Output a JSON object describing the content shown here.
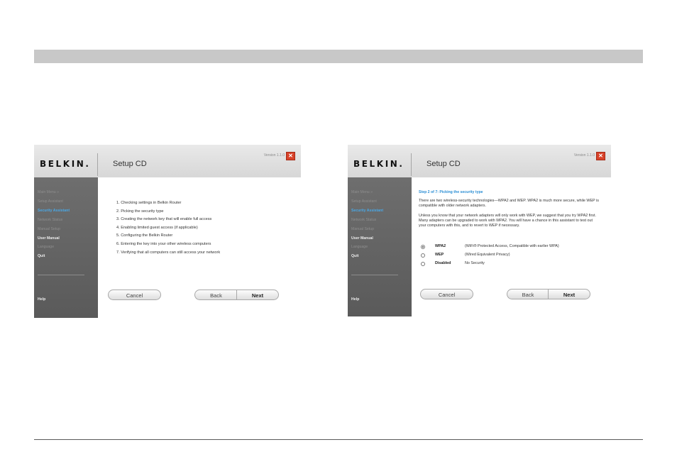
{
  "window_left": {
    "logo": "BELKIN.",
    "title": "Setup CD",
    "version": "Version 1.1.0",
    "sidebar": {
      "items": [
        {
          "label": "Main Menu  »"
        },
        {
          "label": "Setup Assistant"
        },
        {
          "label": "Security Assistant"
        },
        {
          "label": "Network Status"
        },
        {
          "label": "Manual Setup"
        },
        {
          "label": "User Manual"
        },
        {
          "label": "Language"
        },
        {
          "label": "Quit"
        }
      ],
      "help": "Help"
    },
    "steps": [
      "1. Checking settings in Belkin Router",
      "2. Picking the security type",
      "3. Creating the network key that will enable full access",
      "4. Enabling limited guest access (if applicable)",
      "5. Configuring the Belkin Router",
      "6. Entering the key into your other wireless computers",
      "7. Verifying that all computers can still access your network"
    ],
    "buttons": {
      "cancel": "Cancel",
      "back": "Back",
      "next": "Next"
    }
  },
  "window_right": {
    "logo": "BELKIN.",
    "title": "Setup CD",
    "version": "Version 1.1.0",
    "sidebar": {
      "items": [
        {
          "label": "Main Menu  »"
        },
        {
          "label": "Setup Assistant"
        },
        {
          "label": "Security Assistant"
        },
        {
          "label": "Network Status"
        },
        {
          "label": "Manual Setup"
        },
        {
          "label": "User Manual"
        },
        {
          "label": "Language"
        },
        {
          "label": "Quit"
        }
      ],
      "help": "Help"
    },
    "step_header": "Step 2 of 7: Picking the security type",
    "para1": "There are two wireless-security technologies—WPA2 and WEP. WPA2 is much more secure, while WEP is compatible with older network adapters.",
    "para2": "Unless you know that your network adapters will only work with WEP, we suggest that you try WPA2 first. Many adapters can be upgraded to work with WPA2. You will have a chance in this assistant to test out your computers with this, and to revert to WEP if necessary.",
    "options": [
      {
        "label": "WPA2",
        "description": "(WiFi® Protected Access, Compatible with earlier WPA)",
        "selected": true
      },
      {
        "label": "WEP",
        "description": "(Wired Equivalent Privacy)",
        "selected": false
      },
      {
        "label": "Disabled",
        "description": "No Security",
        "selected": false
      }
    ],
    "buttons": {
      "cancel": "Cancel",
      "back": "Back",
      "next": "Next"
    }
  },
  "colors": {
    "accent": "#49a8e6",
    "step_header": "#2b8ed4",
    "close": "#d9432a",
    "sidebar": "#646464",
    "band": "#c8c8c8"
  }
}
